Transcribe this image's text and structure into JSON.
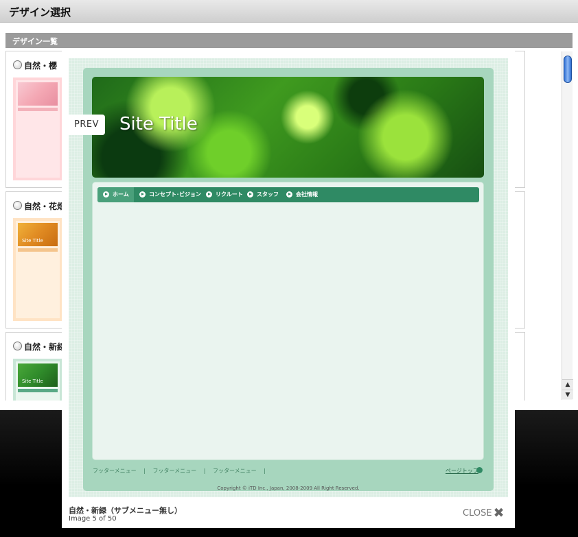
{
  "page": {
    "title": "デザイン選択",
    "section_title": "デザイン一覧"
  },
  "designs": [
    {
      "name": "自然・櫻",
      "thumb_title": "",
      "border_color": "#ffd6d9",
      "bg_color": "#ffe6e8",
      "head_color": "#f4a8b4",
      "nav_color": "#f3b2ba"
    },
    {
      "name": "自然・花畑",
      "thumb_title": "Site Title",
      "border_color": "#ffe3c4",
      "bg_color": "#fff0de",
      "head_color": "#e08a22",
      "nav_color": "#f4c48c"
    },
    {
      "name": "自然・新緑",
      "thumb_title": "Site Title",
      "border_color": "#c8e6d6",
      "bg_color": "#eaf6ef",
      "head_color": "#2f8b2a",
      "nav_color": "#5aa986"
    }
  ],
  "scrollbar": {
    "up_icon": "▲",
    "down_icon": "▼"
  },
  "lightbox": {
    "prev_label": "PREV",
    "preview": {
      "site_title": "Site Title",
      "nav_items": [
        {
          "label": "ホーム"
        },
        {
          "label": "コンセプト･ビジョン"
        },
        {
          "label": "リクルート"
        },
        {
          "label": "スタッフ"
        },
        {
          "label": "会社情報"
        }
      ],
      "footer_links": [
        "フッターメニュー",
        "|",
        "フッターメニュー",
        "|",
        "フッターメニュー",
        "|"
      ],
      "pagetop_label": "ページトップ",
      "copyright": "Copyright © iTD Inc., Japan, 2008-2009 All Right Reserved."
    },
    "caption_title": "自然・新緑（サブメニュー無し）",
    "caption_count": "Image 5 of 50",
    "close_label": "CLOSE",
    "close_icon": "✖"
  },
  "colors": {
    "accent_green": "#2f8a64",
    "frame_green": "#a7d6be",
    "scroll_blue": "#2f6fd3"
  }
}
